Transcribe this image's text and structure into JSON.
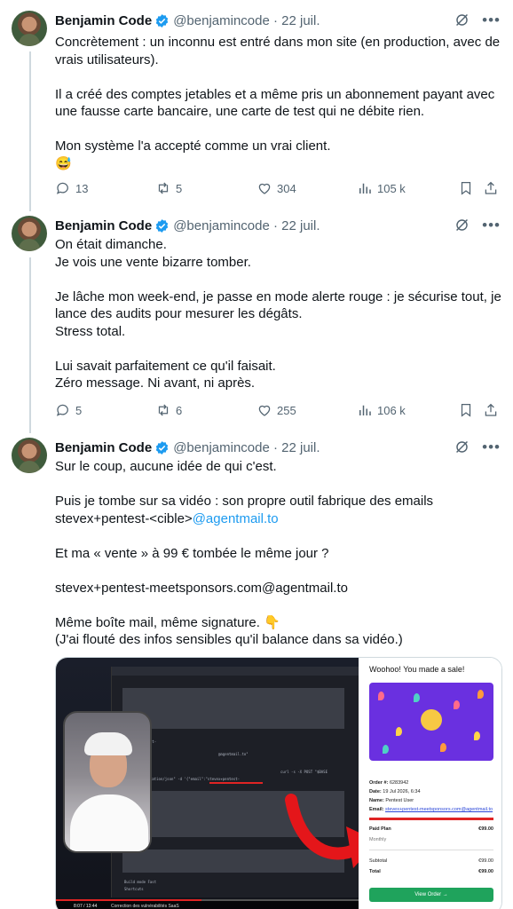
{
  "tweets": [
    {
      "name": "Benjamin Code",
      "handle": "@benjamincode · 22 juil.",
      "paragraphs": [
        "Concrètement : un inconnu est entré dans mon site (en production, avec de vrais utilisateurs).",
        "",
        "Il a créé des comptes jetables et a même pris un abonnement payant avec une fausse carte bancaire, une carte de test qui ne débite rien.",
        "",
        "Mon système l'a accepté comme un vrai client.",
        "😅"
      ],
      "replies": "13",
      "retweets": "5",
      "likes": "304",
      "views": "105 k"
    },
    {
      "name": "Benjamin Code",
      "handle": "@benjamincode · 22 juil.",
      "paragraphs": [
        "On était dimanche.",
        "Je vois une vente bizarre tomber.",
        "",
        "Je lâche mon week-end, je passe en mode alerte rouge : je sécurise tout, je lance des audits pour mesurer les dégâts.",
        "Stress total.",
        "",
        "Lui savait parfaitement ce qu'il faisait.",
        "Zéro message. Ni avant, ni après."
      ],
      "replies": "5",
      "retweets": "6",
      "likes": "255",
      "views": "106 k"
    },
    {
      "name": "Benjamin Code",
      "handle": "@benjamincode · 22 juil.",
      "paragraphs": [
        "Sur le coup, aucune idée de qui c'est.",
        "",
        "Puis je tombe sur sa vidéo : son propre outil fabrique des emails",
        "",
        "",
        "Et ma « vente » à 99 € tombée le même jour ?",
        "",
        "stevex+pentest-meetsponsors.com@agentmail.to",
        "",
        "Même boîte mail, même signature. 👇",
        "(J'ai flouté des infos sensibles qu'il balance dans sa vidéo.)"
      ],
      "email_prefix": "stevex+pentest-<cible>",
      "email_link": "@agentmail.to"
    }
  ],
  "media": {
    "receipt_title": "Woohoo! You made a sale!",
    "order_label": "Order #:",
    "order_value": "6283942",
    "date_label": "Date:",
    "date_value": "19 Jul 2026, 6:34",
    "name_label": "Name:",
    "name_value": "Pentest User",
    "email_label": "Email:",
    "email_value": "stevex+pentest-meetsponsors.com@agentmail.to",
    "plan_label": "Paid Plan",
    "plan_price": "€99.00",
    "plan_period": "Monthly",
    "subtotal_label": "Subtotal",
    "subtotal_value": "€99.00",
    "total_label": "Total",
    "total_value": "€99.00",
    "button_label": "View Order →",
    "video_time": "8:07 / 13:44",
    "video_chapter": "Correction des vulnérabilités SaaS",
    "term_lines": [
      "stevex+pentest-",
      "@agentmail.to\"",
      "curl -s -X POST \"$BASE",
      "-type: application/json\" -d '{\"email\":\"stevex+pentest-",
      "Build mode   Fast",
      "Shortcuts"
    ]
  },
  "colors": {
    "link": "#1d9bf0",
    "muted": "#536471",
    "verified": "#1d9bf0"
  }
}
